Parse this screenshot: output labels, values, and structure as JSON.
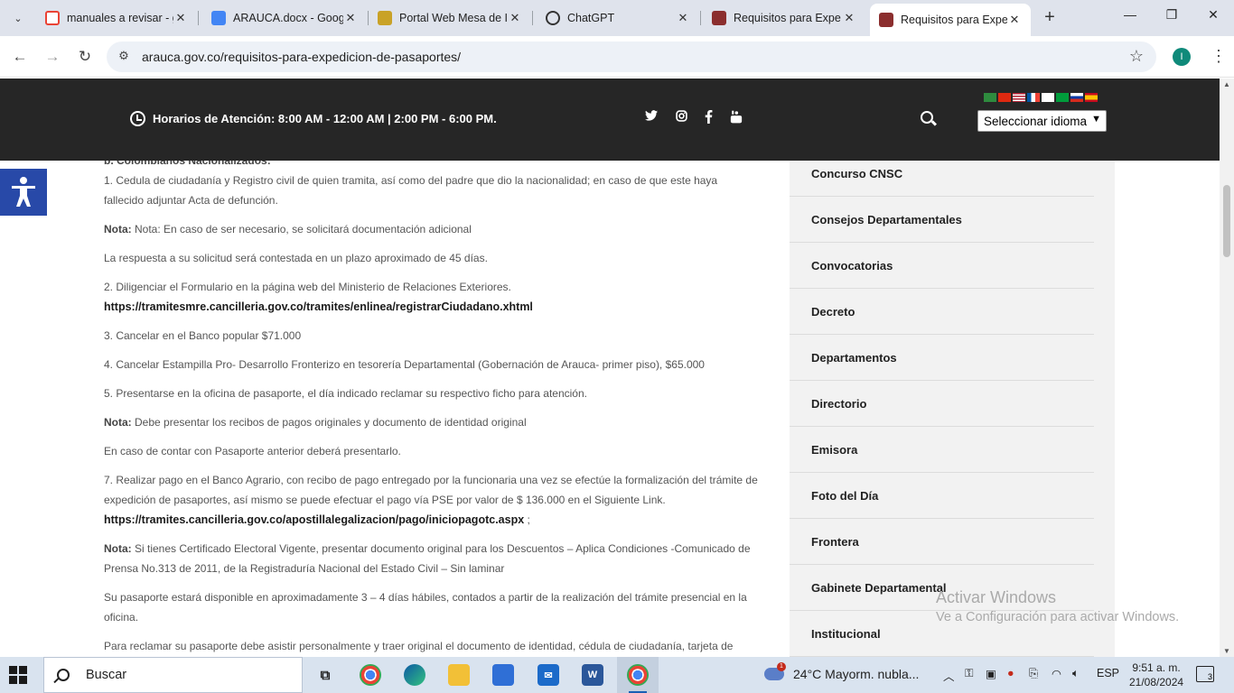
{
  "browser": {
    "tabs": [
      {
        "title": "manuales a revisar - g",
        "favicon": "gmail-icon",
        "color": "#ea4335"
      },
      {
        "title": "ARAUCA.docx - Goog",
        "favicon": "docs-icon",
        "color": "#4285f4"
      },
      {
        "title": "Portal Web Mesa de I",
        "favicon": "portal-icon",
        "color": "#c9a227"
      },
      {
        "title": "ChatGPT",
        "favicon": "chatgpt-icon",
        "color": "#333333"
      },
      {
        "title": "Requisitos para Expe",
        "favicon": "arauca-icon",
        "color": "#8b2e2e"
      },
      {
        "title": "Requisitos para Expe",
        "favicon": "arauca-icon",
        "color": "#8b2e2e"
      }
    ],
    "url": "arauca.gov.co/requisitos-para-expedicion-de-pasaportes/",
    "profile_initial": "I"
  },
  "topbar": {
    "hours": "Horarios de Atención: 8:00 AM - 12:00 AM | 2:00 PM - 6:00 PM.",
    "language_select": "Seleccionar idioma"
  },
  "content": {
    "subheading": "b. Colombianos Nacionalizados:",
    "p1": "1. Cedula de ciudadanía y Registro civil de quien tramita, así como del padre que dio la nacionalidad; en caso de que este haya fallecido adjuntar Acta de defunción.",
    "nota1_label": "Nota:",
    "nota1_text": " Nota: En caso de ser necesario, se solicitará documentación adicional",
    "p2": "La respuesta a su solicitud será contestada en un plazo aproximado de 45 días.",
    "p3": "2. Diligenciar el Formulario en la página web del Ministerio de Relaciones Exteriores.",
    "link1": "https://tramitesmre.cancilleria.gov.co/tramites/enlinea/registrarCiudadano.xhtml",
    "p4": "3. Cancelar en el Banco popular $71.000",
    "p5": "4. Cancelar Estampilla Pro- Desarrollo Fronterizo en tesorería Departamental (Gobernación de Arauca- primer piso), $65.000",
    "p6": "5. Presentarse en la oficina de pasaporte, el día indicado reclamar su respectivo ficho para atención.",
    "nota2_label": "Nota:",
    "nota2_text": " Debe presentar los recibos de pagos originales y documento de identidad original",
    "p7": "En caso de contar con Pasaporte anterior deberá presentarlo.",
    "p8": "7. Realizar pago en el Banco Agrario, con recibo de pago entregado por la funcionaria una vez se efectúe la formalización del trámite de expedición de pasaportes, así mismo se puede efectuar el pago vía PSE por valor de $ 136.000 en el Siguiente Link. ",
    "link2": "https://tramites.cancilleria.gov.co/apostillalegalizacion/pago/iniciopagotc.aspx",
    "link2_suffix": " ;",
    "nota3_label": "Nota:",
    "nota3_text": " Si tienes Certificado Electoral Vigente, presentar documento original para los Descuentos – Aplica Condiciones -Comunicado de Prensa No.313 de 2011, de la Registraduría Nacional del Estado Civil – Sin laminar",
    "p9": "Su pasaporte estará disponible en aproximadamente 3 – 4 días hábiles, contados a partir de la realización del trámite presencial en la oficina.",
    "p10": "Para reclamar su pasaporte debe asistir personalmente y traer original el documento de identidad, cédula de ciudadanía, tarjeta de"
  },
  "sidebar": {
    "items": [
      "Concurso CNSC",
      "Consejos Departamentales",
      "Convocatorias",
      "Decreto",
      "Departamentos",
      "Directorio",
      "Emisora",
      "Foto del Día",
      "Frontera",
      "Gabinete Departamental",
      "Institucional"
    ]
  },
  "watermark": {
    "line1": "Activar Windows",
    "line2": "Ve a Configuración para activar Windows."
  },
  "taskbar": {
    "search": "Buscar",
    "weather": "24°C  Mayorm. nubla...",
    "weather_badge": "1",
    "language": "ESP",
    "time": "9:51 a. m.",
    "date": "21/08/2024",
    "notifications": "3"
  }
}
